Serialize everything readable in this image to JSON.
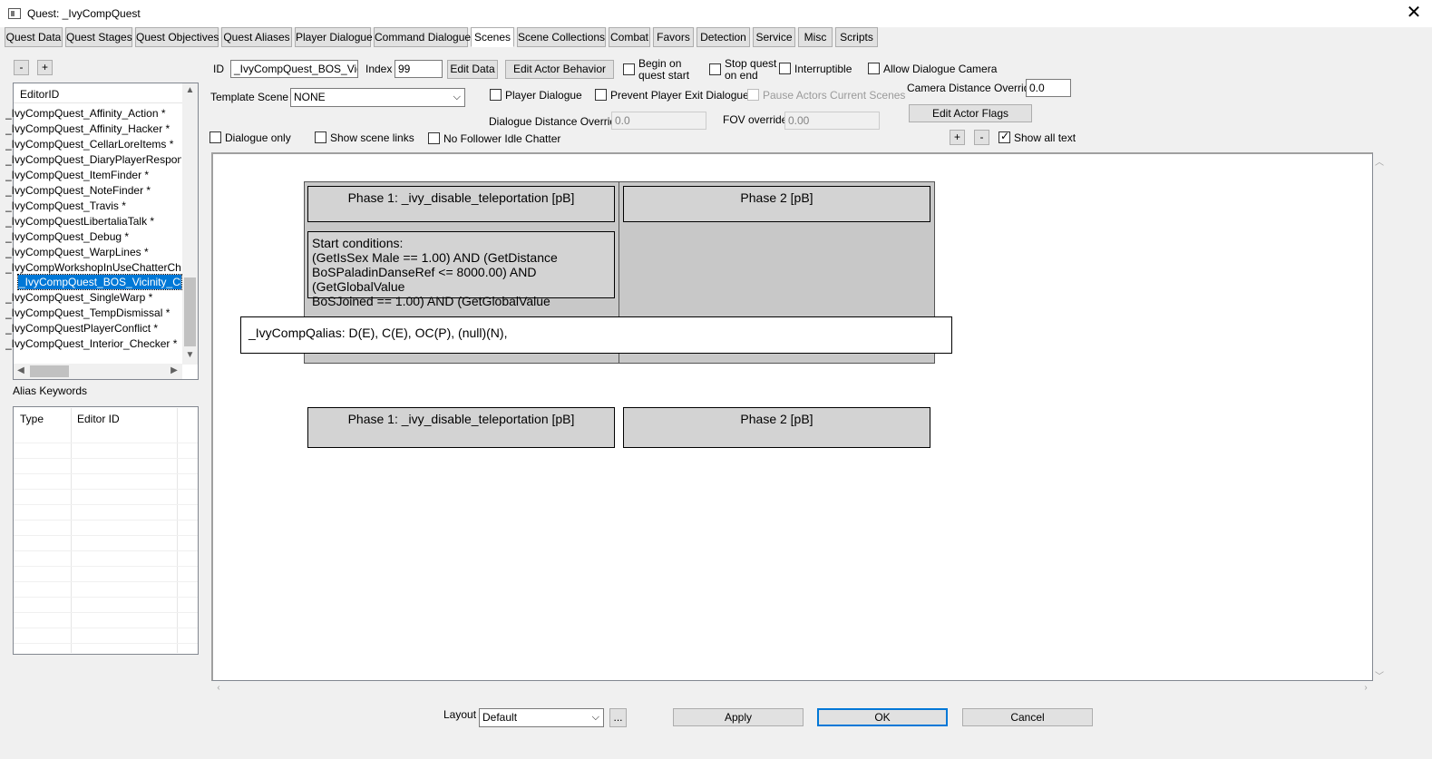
{
  "window": {
    "title": "Quest: _IvyCompQuest",
    "close_glyph": "✕",
    "icon": "app-window-icon"
  },
  "tabs": [
    {
      "label": "Quest Data"
    },
    {
      "label": "Quest Stages"
    },
    {
      "label": "Quest Objectives"
    },
    {
      "label": "Quest Aliases"
    },
    {
      "label": "Player Dialogue"
    },
    {
      "label": "Command Dialogue"
    },
    {
      "label": "Scenes"
    },
    {
      "label": "Scene Collections"
    },
    {
      "label": "Combat"
    },
    {
      "label": "Favors"
    },
    {
      "label": "Detection"
    },
    {
      "label": "Service"
    },
    {
      "label": "Misc"
    },
    {
      "label": "Scripts"
    }
  ],
  "active_tab": "Scenes",
  "left_panel": {
    "minus_label": "-",
    "plus_label": "+",
    "list_header": "EditorID",
    "items": [
      "_IvyCompQuest_Affinity_Action *",
      "_IvyCompQuest_Affinity_Hacker *",
      "_IvyCompQuest_CellarLoreItems *",
      "_IvyCompQuest_DiaryPlayerResponse",
      "_IvyCompQuest_ItemFinder *",
      "_IvyCompQuest_NoteFinder *",
      "_IvyCompQuest_Travis *",
      "_IvyCompQuestLibertaliaTalk *",
      "_IvyCompQuest_Debug *",
      "_IvyCompQuest_WarpLines *",
      "_IvyCompWorkshopInUseChatterChec",
      "_IvyCompQuest_BOS_Vicinity_Check",
      "_IvyCompQuest_SingleWarp *",
      "_IvyCompQuest_TempDismissal *",
      "_IvyCompQuestPlayerConflict *",
      "_IvyCompQuest_Interior_Checker *"
    ],
    "selected_index": 11,
    "alias_keywords_label": "Alias Keywords",
    "alias_columns": [
      "Type",
      "Editor ID"
    ]
  },
  "form": {
    "id_label": "ID",
    "id_value": "_IvyCompQuest_BOS_Vicinity_Check",
    "index_label": "Index",
    "index_value": "99",
    "edit_data_button": "Edit Data",
    "edit_actor_behavior_button": "Edit Actor Behavior",
    "begin_on_quest_start_line1": "Begin on",
    "begin_on_quest_start_line2": "quest start",
    "stop_quest_on_end_line1": "Stop quest",
    "stop_quest_on_end_line2": "on end",
    "interruptible_label": "Interruptible",
    "allow_dialogue_camera_label": "Allow Dialogue Camera",
    "template_scene_label": "Template Scene",
    "template_scene_value": "NONE",
    "player_dialogue_label": "Player Dialogue",
    "prevent_player_exit_label": "Prevent Player Exit Dialogue",
    "pause_actors_label": "Pause Actors Current Scenes",
    "camera_distance_label": "Camera Distance Override",
    "camera_distance_value": "0.0",
    "dialogue_distance_label": "Dialogue Distance Override",
    "dialogue_distance_value": "0.0",
    "fov_override_label": "FOV override",
    "fov_override_value": "0.00",
    "edit_actor_flags_button": "Edit Actor Flags",
    "dialogue_only_label": "Dialogue only",
    "show_scene_links_label": "Show scene links",
    "no_follower_idle_label": "No Follower Idle Chatter",
    "zoom_plus": "+",
    "zoom_minus": "-",
    "show_all_text_label": "Show all text",
    "show_all_text_checked": true
  },
  "scene": {
    "phase1_title": "Phase 1: _ivy_disable_teleportation [pB]",
    "phase2_title": "Phase 2 [pB]",
    "start_conditions": [
      "Start conditions:",
      "(GetIsSex Male == 1.00) AND (GetDistance",
      "BoSPaladinDanseRef <= 8000.00) AND (GetGlobalValue",
      "BoSJoined == 1.00) AND (GetGlobalValue"
    ],
    "alias_line": "_IvyCompQalias: D(E), C(E), OC(P), (null)(N),",
    "phase1_title_lower": "Phase 1: _ivy_disable_teleportation [pB]",
    "phase2_title_lower": "Phase 2 [pB]"
  },
  "footer": {
    "layout_label": "Layout",
    "layout_value": "Default",
    "ellipsis_button": "...",
    "apply_button": "Apply",
    "ok_button": "OK",
    "cancel_button": "Cancel"
  }
}
